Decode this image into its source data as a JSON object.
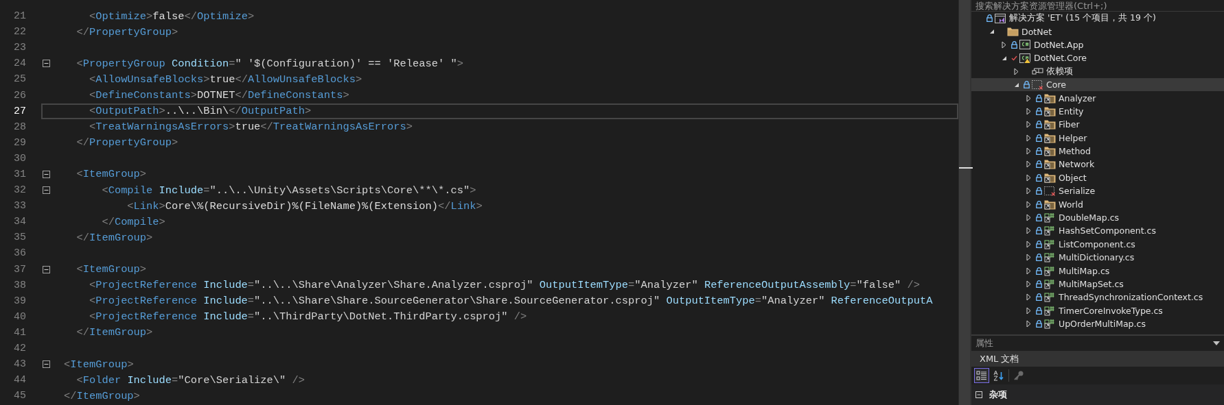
{
  "editor": {
    "lines": [
      {
        "number": "21",
        "current": false,
        "tokens": [
          {
            "kind": "bracket",
            "text": "    <"
          },
          {
            "kind": "tag",
            "text": "Optimize"
          },
          {
            "kind": "bracket",
            "text": ">"
          },
          {
            "kind": "text",
            "text": "false"
          },
          {
            "kind": "bracket",
            "text": "</"
          },
          {
            "kind": "tag",
            "text": "Optimize"
          },
          {
            "kind": "bracket",
            "text": ">"
          }
        ]
      },
      {
        "number": "22",
        "current": false,
        "tokens": [
          {
            "kind": "bracket",
            "text": "  </"
          },
          {
            "kind": "tag",
            "text": "PropertyGroup"
          },
          {
            "kind": "bracket",
            "text": ">"
          }
        ]
      },
      {
        "number": "23",
        "current": false
      },
      {
        "number": "24",
        "current": false,
        "foldable": true,
        "tokens": [
          {
            "kind": "bracket",
            "text": "  <"
          },
          {
            "kind": "tag",
            "text": "PropertyGroup"
          },
          {
            "kind": "attr",
            "text": " Condition"
          },
          {
            "kind": "bracket",
            "text": "="
          },
          {
            "kind": "value",
            "text": "\" '$(Configuration)' == 'Release' \""
          },
          {
            "kind": "bracket",
            "text": ">"
          }
        ]
      },
      {
        "number": "25",
        "current": false,
        "tokens": [
          {
            "kind": "bracket",
            "text": "    <"
          },
          {
            "kind": "tag",
            "text": "AllowUnsafeBlocks"
          },
          {
            "kind": "bracket",
            "text": ">"
          },
          {
            "kind": "text",
            "text": "true"
          },
          {
            "kind": "bracket",
            "text": "</"
          },
          {
            "kind": "tag",
            "text": "AllowUnsafeBlocks"
          },
          {
            "kind": "bracket",
            "text": ">"
          }
        ]
      },
      {
        "number": "26",
        "current": false,
        "tokens": [
          {
            "kind": "bracket",
            "text": "    <"
          },
          {
            "kind": "tag",
            "text": "DefineConstants"
          },
          {
            "kind": "bracket",
            "text": ">"
          },
          {
            "kind": "text",
            "text": "DOTNET"
          },
          {
            "kind": "bracket",
            "text": "</"
          },
          {
            "kind": "tag",
            "text": "DefineConstants"
          },
          {
            "kind": "bracket",
            "text": ">"
          }
        ]
      },
      {
        "number": "27",
        "current": true,
        "tokens": [
          {
            "kind": "bracket",
            "text": "    <"
          },
          {
            "kind": "tag",
            "text": "OutputPath"
          },
          {
            "kind": "bracket",
            "text": ">"
          },
          {
            "kind": "text",
            "text": "..\\..\\Bin\\"
          },
          {
            "kind": "bracket",
            "text": "</"
          },
          {
            "kind": "tag",
            "text": "OutputPath"
          },
          {
            "kind": "bracket",
            "text": ">"
          }
        ]
      },
      {
        "number": "28",
        "current": false,
        "tokens": [
          {
            "kind": "bracket",
            "text": "    <"
          },
          {
            "kind": "tag",
            "text": "TreatWarningsAsErrors"
          },
          {
            "kind": "bracket",
            "text": ">"
          },
          {
            "kind": "text",
            "text": "true"
          },
          {
            "kind": "bracket",
            "text": "</"
          },
          {
            "kind": "tag",
            "text": "TreatWarningsAsErrors"
          },
          {
            "kind": "bracket",
            "text": ">"
          }
        ]
      },
      {
        "number": "29",
        "current": false,
        "tokens": [
          {
            "kind": "bracket",
            "text": "  </"
          },
          {
            "kind": "tag",
            "text": "PropertyGroup"
          },
          {
            "kind": "bracket",
            "text": ">"
          }
        ]
      },
      {
        "number": "30",
        "current": false
      },
      {
        "number": "31",
        "current": false,
        "foldable": true,
        "tokens": [
          {
            "kind": "bracket",
            "text": "  <"
          },
          {
            "kind": "tag",
            "text": "ItemGroup"
          },
          {
            "kind": "bracket",
            "text": ">"
          }
        ]
      },
      {
        "number": "32",
        "current": false,
        "foldable": true,
        "tokens": [
          {
            "kind": "bracket",
            "text": "      <"
          },
          {
            "kind": "tag",
            "text": "Compile"
          },
          {
            "kind": "attr",
            "text": " Include"
          },
          {
            "kind": "bracket",
            "text": "="
          },
          {
            "kind": "value",
            "text": "\"..\\..\\Unity\\Assets\\Scripts\\Core\\**\\*.cs\""
          },
          {
            "kind": "bracket",
            "text": ">"
          }
        ]
      },
      {
        "number": "33",
        "current": false,
        "tokens": [
          {
            "kind": "bracket",
            "text": "          <"
          },
          {
            "kind": "tag",
            "text": "Link"
          },
          {
            "kind": "bracket",
            "text": ">"
          },
          {
            "kind": "text",
            "text": "Core\\%(RecursiveDir)%(FileName)%(Extension)"
          },
          {
            "kind": "bracket",
            "text": "</"
          },
          {
            "kind": "tag",
            "text": "Link"
          },
          {
            "kind": "bracket",
            "text": ">"
          }
        ]
      },
      {
        "number": "34",
        "current": false,
        "tokens": [
          {
            "kind": "bracket",
            "text": "      </"
          },
          {
            "kind": "tag",
            "text": "Compile"
          },
          {
            "kind": "bracket",
            "text": ">"
          }
        ]
      },
      {
        "number": "35",
        "current": false,
        "tokens": [
          {
            "kind": "bracket",
            "text": "  </"
          },
          {
            "kind": "tag",
            "text": "ItemGroup"
          },
          {
            "kind": "bracket",
            "text": ">"
          }
        ]
      },
      {
        "number": "36",
        "current": false
      },
      {
        "number": "37",
        "current": false,
        "foldable": true,
        "tokens": [
          {
            "kind": "bracket",
            "text": "  <"
          },
          {
            "kind": "tag",
            "text": "ItemGroup"
          },
          {
            "kind": "bracket",
            "text": ">"
          }
        ]
      },
      {
        "number": "38",
        "current": false,
        "tokens": [
          {
            "kind": "bracket",
            "text": "    <"
          },
          {
            "kind": "tag",
            "text": "ProjectReference"
          },
          {
            "kind": "attr",
            "text": " Include"
          },
          {
            "kind": "bracket",
            "text": "="
          },
          {
            "kind": "value",
            "text": "\"..\\..\\Share\\Analyzer\\Share.Analyzer.csproj\""
          },
          {
            "kind": "attr",
            "text": " OutputItemType"
          },
          {
            "kind": "bracket",
            "text": "="
          },
          {
            "kind": "value",
            "text": "\"Analyzer\""
          },
          {
            "kind": "attr",
            "text": " ReferenceOutputAssembly"
          },
          {
            "kind": "bracket",
            "text": "="
          },
          {
            "kind": "value",
            "text": "\"false\""
          },
          {
            "kind": "bracket",
            "text": " />"
          }
        ]
      },
      {
        "number": "39",
        "current": false,
        "tokens": [
          {
            "kind": "bracket",
            "text": "    <"
          },
          {
            "kind": "tag",
            "text": "ProjectReference"
          },
          {
            "kind": "attr",
            "text": " Include"
          },
          {
            "kind": "bracket",
            "text": "="
          },
          {
            "kind": "value",
            "text": "\"..\\..\\Share\\Share.SourceGenerator\\Share.SourceGenerator.csproj\""
          },
          {
            "kind": "attr",
            "text": " OutputItemType"
          },
          {
            "kind": "bracket",
            "text": "="
          },
          {
            "kind": "value",
            "text": "\"Analyzer\""
          },
          {
            "kind": "attr",
            "text": " ReferenceOutputA"
          }
        ]
      },
      {
        "number": "40",
        "current": false,
        "tokens": [
          {
            "kind": "bracket",
            "text": "    <"
          },
          {
            "kind": "tag",
            "text": "ProjectReference"
          },
          {
            "kind": "attr",
            "text": " Include"
          },
          {
            "kind": "bracket",
            "text": "="
          },
          {
            "kind": "value",
            "text": "\"..\\ThirdParty\\DotNet.ThirdParty.csproj\""
          },
          {
            "kind": "bracket",
            "text": " />"
          }
        ]
      },
      {
        "number": "41",
        "current": false,
        "tokens": [
          {
            "kind": "bracket",
            "text": "  </"
          },
          {
            "kind": "tag",
            "text": "ItemGroup"
          },
          {
            "kind": "bracket",
            "text": ">"
          }
        ]
      },
      {
        "number": "42",
        "current": false
      },
      {
        "number": "43",
        "current": false,
        "foldable": true,
        "tokens": [
          {
            "kind": "bracket",
            "text": "<"
          },
          {
            "kind": "tag",
            "text": "ItemGroup"
          },
          {
            "kind": "bracket",
            "text": ">"
          }
        ]
      },
      {
        "number": "44",
        "current": false,
        "tokens": [
          {
            "kind": "bracket",
            "text": "  <"
          },
          {
            "kind": "tag",
            "text": "Folder"
          },
          {
            "kind": "attr",
            "text": " Include"
          },
          {
            "kind": "bracket",
            "text": "="
          },
          {
            "kind": "value",
            "text": "\"Core\\Serialize\\\""
          },
          {
            "kind": "bracket",
            "text": " />"
          }
        ]
      },
      {
        "number": "45",
        "current": false,
        "tokens": [
          {
            "kind": "bracket",
            "text": "</"
          },
          {
            "kind": "tag",
            "text": "ItemGroup"
          },
          {
            "kind": "bracket",
            "text": ">"
          }
        ]
      }
    ]
  },
  "solution_explorer": {
    "search": {
      "placeholder": "搜索解决方案资源管理器(Ctrl+;)"
    },
    "tree": [
      {
        "label": "解决方案 'ET' (15 个项目，共 19 个)",
        "kind": "solution",
        "locked": true,
        "pending": false,
        "selected": false,
        "children": [
          {
            "label": "DotNet",
            "kind": "folder",
            "locked": false,
            "pending": false,
            "selected": false,
            "expanded": true,
            "children": [
              {
                "label": "DotNet.App",
                "kind": "csharp-project",
                "locked": true,
                "pending": false,
                "selected": false,
                "expanded": false
              },
              {
                "label": "DotNet.Core",
                "kind": "csharp-project-warning",
                "locked": false,
                "pending": true,
                "selected": false,
                "expanded": true,
                "children": [
                  {
                    "label": "依赖项",
                    "kind": "dependencies",
                    "locked": false,
                    "pending": false,
                    "selected": false,
                    "expanded": false
                  },
                  {
                    "label": "Core",
                    "kind": "missing-folder",
                    "locked": true,
                    "pending": false,
                    "selected": true,
                    "expanded": true,
                    "children": [
                      {
                        "label": "Analyzer",
                        "kind": "linked-folder",
                        "locked": true,
                        "pending": false,
                        "selected": false,
                        "expanded": false
                      },
                      {
                        "label": "Entity",
                        "kind": "linked-folder",
                        "locked": true,
                        "pending": false,
                        "selected": false,
                        "expanded": false
                      },
                      {
                        "label": "Fiber",
                        "kind": "linked-folder",
                        "locked": true,
                        "pending": false,
                        "selected": false,
                        "expanded": false
                      },
                      {
                        "label": "Helper",
                        "kind": "linked-folder",
                        "locked": true,
                        "pending": false,
                        "selected": false,
                        "expanded": false
                      },
                      {
                        "label": "Method",
                        "kind": "linked-folder",
                        "locked": true,
                        "pending": false,
                        "selected": false,
                        "expanded": false
                      },
                      {
                        "label": "Network",
                        "kind": "linked-folder",
                        "locked": true,
                        "pending": false,
                        "selected": false,
                        "expanded": false
                      },
                      {
                        "label": "Object",
                        "kind": "linked-folder",
                        "locked": true,
                        "pending": false,
                        "selected": false,
                        "expanded": false
                      },
                      {
                        "label": "Serialize",
                        "kind": "missing-folder",
                        "locked": true,
                        "pending": false,
                        "selected": false,
                        "expanded": false
                      },
                      {
                        "label": "World",
                        "kind": "linked-folder",
                        "locked": true,
                        "pending": false,
                        "selected": false,
                        "expanded": false
                      },
                      {
                        "label": "DoubleMap.cs",
                        "kind": "linked-cs-file",
                        "locked": true,
                        "pending": false,
                        "selected": false,
                        "expanded": false
                      },
                      {
                        "label": "HashSetComponent.cs",
                        "kind": "linked-cs-file",
                        "locked": true,
                        "pending": false,
                        "selected": false,
                        "expanded": false
                      },
                      {
                        "label": "ListComponent.cs",
                        "kind": "linked-cs-file",
                        "locked": true,
                        "pending": false,
                        "selected": false,
                        "expanded": false
                      },
                      {
                        "label": "MultiDictionary.cs",
                        "kind": "linked-cs-file",
                        "locked": true,
                        "pending": false,
                        "selected": false,
                        "expanded": false
                      },
                      {
                        "label": "MultiMap.cs",
                        "kind": "linked-cs-file",
                        "locked": true,
                        "pending": false,
                        "selected": false,
                        "expanded": false
                      },
                      {
                        "label": "MultiMapSet.cs",
                        "kind": "linked-cs-file",
                        "locked": true,
                        "pending": false,
                        "selected": false,
                        "expanded": false
                      },
                      {
                        "label": "ThreadSynchronizationContext.cs",
                        "kind": "linked-cs-file",
                        "locked": true,
                        "pending": false,
                        "selected": false,
                        "expanded": false
                      },
                      {
                        "label": "TimerCoreInvokeType.cs",
                        "kind": "linked-cs-file",
                        "locked": true,
                        "pending": false,
                        "selected": false,
                        "expanded": false
                      },
                      {
                        "label": "UpOrderMultiMap.cs",
                        "kind": "linked-cs-file",
                        "locked": true,
                        "pending": false,
                        "selected": false,
                        "expanded": false
                      }
                    ]
                  }
                ]
              }
            ]
          }
        ]
      }
    ]
  },
  "properties": {
    "title": "属性",
    "object": "XML 文档",
    "toolbar": [
      {
        "kind": "categorized",
        "selected": true
      },
      {
        "kind": "alphabetical",
        "selected": false
      },
      {
        "kind": "property-pages",
        "selected": false
      }
    ],
    "categories": [
      {
        "label": "杂项",
        "expanded": true
      }
    ]
  }
}
